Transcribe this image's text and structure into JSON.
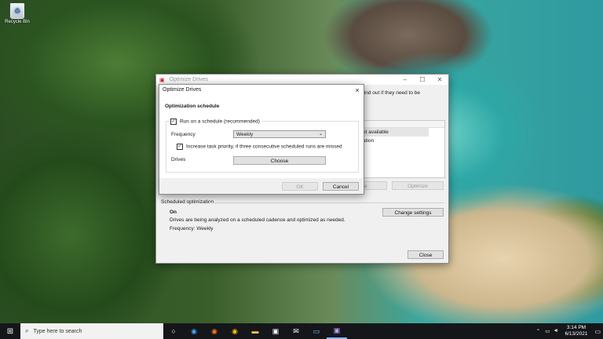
{
  "desktop": {
    "recycle_bin_label": "Recycle Bin"
  },
  "optimize_window": {
    "title": "Optimize Drives",
    "header_text_partial": "find out if they need to be",
    "list_rows": [
      "ot available",
      "ation"
    ],
    "analyze_label": "e",
    "optimize_label": "Optimize",
    "scheduled_heading": "Scheduled optimization",
    "status_on": "On",
    "status_desc": "Drives are being analyzed on a scheduled cadence and optimized as needed.",
    "frequency_text": "Frequency: Weekly",
    "change_settings_label": "Change settings",
    "close_label": "Close"
  },
  "dialog": {
    "title": "Optimize Drives",
    "section_heading": "Optimization schedule",
    "run_schedule_label": "Run on a schedule (recommended)",
    "run_schedule_checked": true,
    "frequency_label": "Frequency",
    "frequency_value": "Weekly",
    "increase_priority_label": "Increase task priority, if three consecutive scheduled runs are missed",
    "increase_priority_checked": true,
    "drives_label": "Drives",
    "choose_label": "Choose",
    "ok_label": "OK",
    "cancel_label": "Cancel",
    "close_glyph": "×"
  },
  "taskbar": {
    "search_placeholder": "Type here to search",
    "time": "3:14 PM",
    "date": "6/13/2021"
  }
}
